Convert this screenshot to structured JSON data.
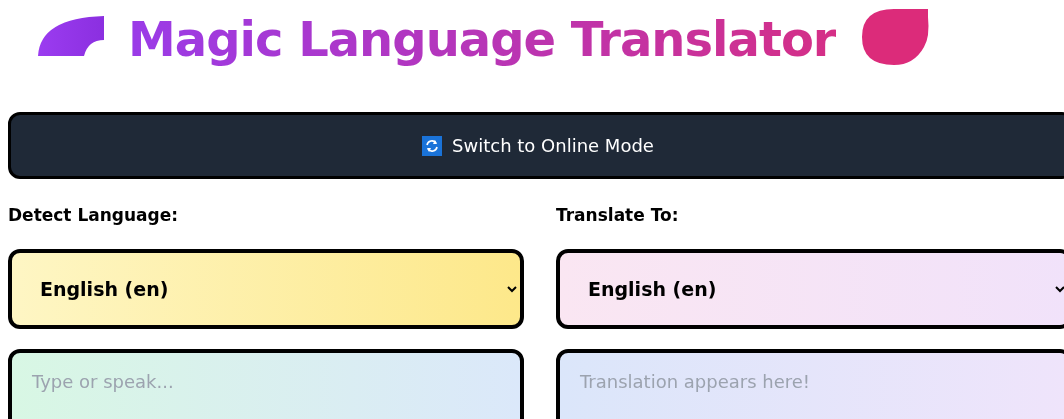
{
  "title": "Magic Language Translator",
  "mode_button": {
    "label": "Switch to Online Mode"
  },
  "source": {
    "label": "Detect Language:",
    "language": "English (en)",
    "placeholder": "Type or speak..."
  },
  "target": {
    "label": "Translate To:",
    "language": "English (en)",
    "placeholder": "Translation appears here!"
  }
}
